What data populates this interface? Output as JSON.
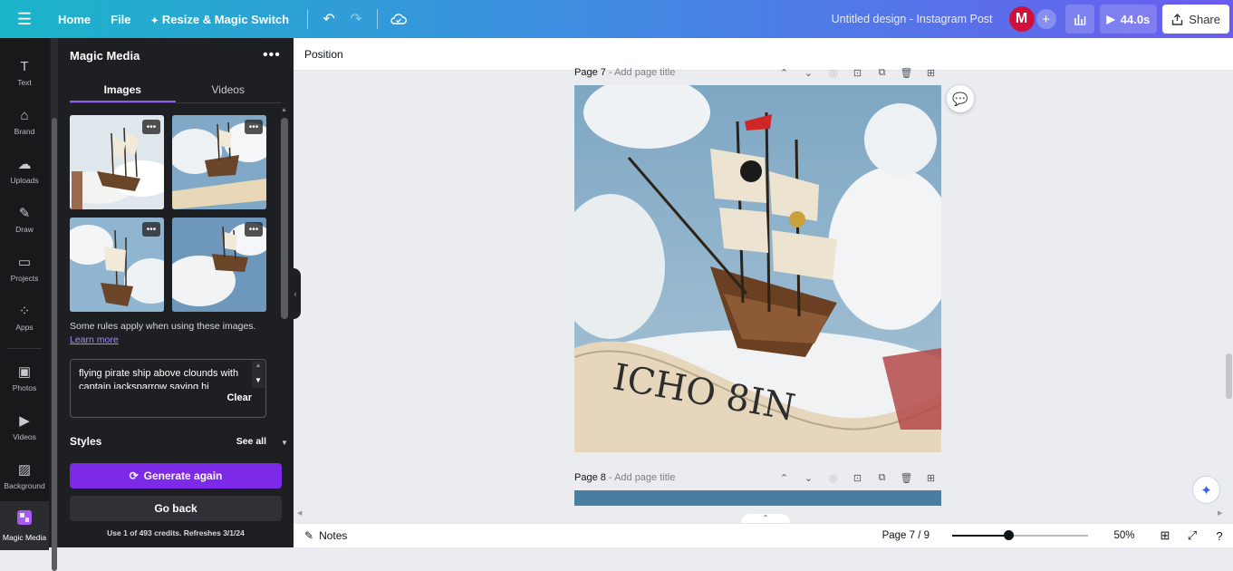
{
  "topbar": {
    "home_label": "Home",
    "file_label": "File",
    "resize_label": "Resize & Magic Switch",
    "doc_title": "Untitled design - Instagram Post",
    "avatar_initial": "M",
    "timer_label": "44.0s",
    "share_label": "Share"
  },
  "rail": {
    "items": [
      {
        "label": "Text",
        "icon": "text-icon"
      },
      {
        "label": "Brand",
        "icon": "brand-icon"
      },
      {
        "label": "Uploads",
        "icon": "upload-icon"
      },
      {
        "label": "Draw",
        "icon": "draw-icon"
      },
      {
        "label": "Projects",
        "icon": "folder-icon"
      },
      {
        "label": "Apps",
        "icon": "apps-icon"
      },
      {
        "label": "Photos",
        "icon": "photo-icon"
      },
      {
        "label": "Videos",
        "icon": "video-icon"
      },
      {
        "label": "Background",
        "icon": "background-icon"
      },
      {
        "label": "Magic Media",
        "icon": "magic-media-icon"
      }
    ]
  },
  "panel": {
    "title": "Magic Media",
    "tabs": [
      {
        "label": "Images",
        "active": true
      },
      {
        "label": "Videos",
        "active": false
      }
    ],
    "rules_text": "Some rules apply when using these images.",
    "rules_link": "Learn more",
    "prompt": "flying pirate ship above clounds with captain jacksparrow saying hi",
    "clear_label": "Clear",
    "styles_label": "Styles",
    "see_all_label": "See all",
    "generate_label": "Generate again",
    "back_label": "Go back",
    "credits_text": "Use 1 of 493 credits. Refreshes 3/1/24"
  },
  "canvas": {
    "context_label": "Position",
    "page7_label": "Page 7",
    "page8_label": "Page 8",
    "page_title_placeholder": "Add page title",
    "banner_text": "ICHO 8IN"
  },
  "bottombar": {
    "notes_label": "Notes",
    "page_count": "Page 7 / 9",
    "zoom_label": "50%",
    "zoom_fraction": 0.41
  },
  "colors": {
    "accent": "#7d2ae8",
    "avatar": "#d0103a",
    "panel_bg": "#1e1f23",
    "rail_bg": "#18191b"
  }
}
